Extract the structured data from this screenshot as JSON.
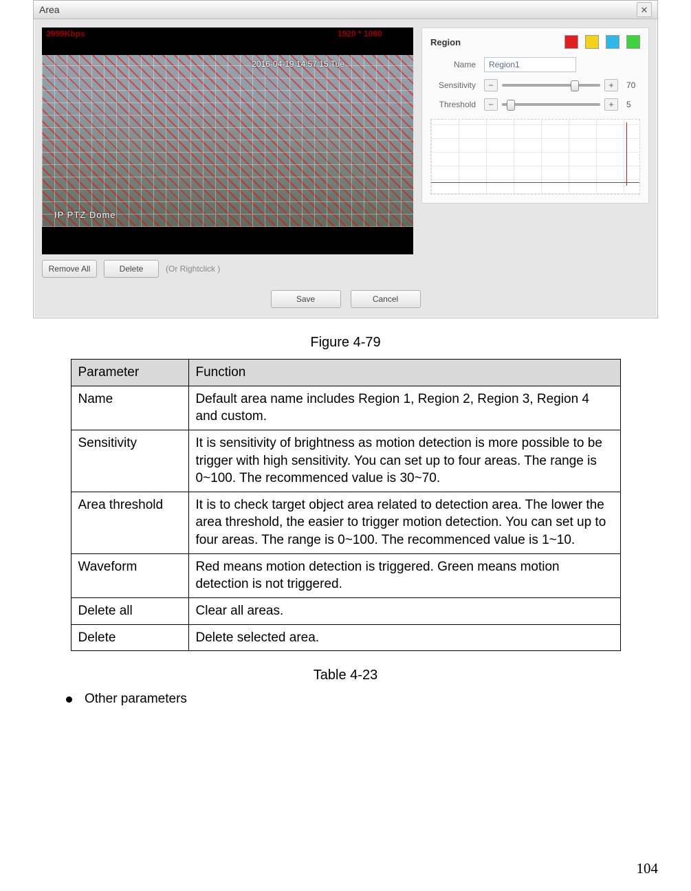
{
  "dialog": {
    "title": "Area",
    "close_glyph": "✕",
    "overlay": {
      "bitrate": "3999Kbps",
      "resolution": "1920 * 1080",
      "timestamp": "2016-04-19 14:57:15 Tue",
      "osd": "IP PTZ Dome"
    },
    "buttons": {
      "remove_all": "Remove All",
      "delete": "Delete",
      "hint": "(Or Rightclick )",
      "save": "Save",
      "cancel": "Cancel"
    },
    "region": {
      "header": "Region",
      "colors": [
        "#e02020",
        "#f2d21a",
        "#2fb7e8",
        "#3fd23f"
      ],
      "name_label": "Name",
      "name_value": "Region1",
      "sensitivity_label": "Sensitivity",
      "sensitivity_value": "70",
      "sensitivity_pos_pct": 70,
      "threshold_label": "Threshold",
      "threshold_value": "5",
      "threshold_pos_pct": 5,
      "minus": "−",
      "plus": "+"
    }
  },
  "figure_caption": "Figure 4-79",
  "table": {
    "head": {
      "parameter": "Parameter",
      "function": "Function"
    },
    "rows": [
      {
        "p": "Name",
        "f": "Default area name includes Region 1, Region 2, Region 3, Region 4 and custom."
      },
      {
        "p": "Sensitivity",
        "f": "It is sensitivity of brightness as motion detection is more possible to be trigger with high sensitivity. You can set up to four areas. The range is 0~100. The recommenced value is 30~70."
      },
      {
        "p": "Area threshold",
        "f": "It is to check target object area related to detection area. The lower the area threshold, the easier to trigger motion detection. You can set up to four areas. The range is 0~100. The recommenced value is 1~10."
      },
      {
        "p": "Waveform",
        "f": "Red means motion detection is triggered. Green means motion detection is not triggered."
      },
      {
        "p": "Delete all",
        "f": "Clear all areas."
      },
      {
        "p": "Delete",
        "f": "Delete selected area."
      }
    ]
  },
  "table_caption": "Table 4-23",
  "bullet_text": "Other parameters",
  "page_number": "104"
}
